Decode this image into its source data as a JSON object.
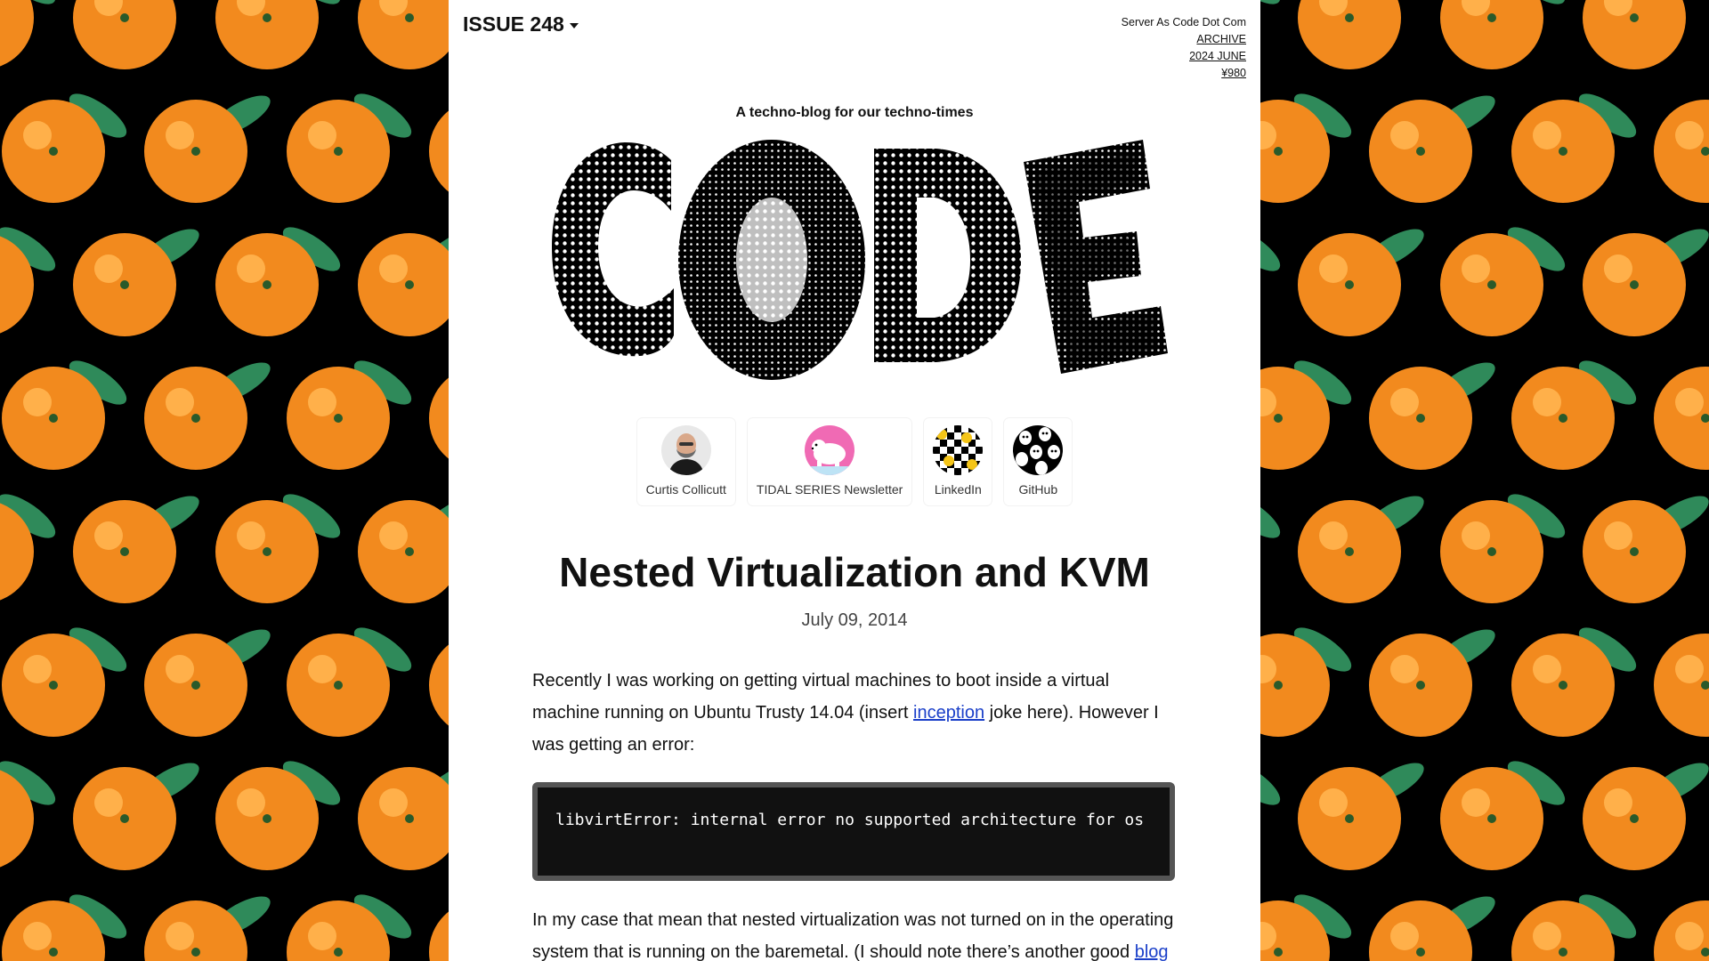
{
  "header": {
    "issue_label": "ISSUE 248",
    "site_name": "Server As Code Dot Com",
    "archive_link": "ARCHIVE",
    "date_link": "2024 JUNE",
    "price_link": "¥980"
  },
  "tagline": "A techno-blog for our techno-times",
  "logo_text": "CODE",
  "social_links": [
    {
      "label": "Curtis Collicutt",
      "icon": "portrait-avatar"
    },
    {
      "label": "TIDAL SERIES Newsletter",
      "icon": "polar-bear-avatar"
    },
    {
      "label": "LinkedIn",
      "icon": "checker-smiley-avatar"
    },
    {
      "label": "GitHub",
      "icon": "ghost-pattern-avatar"
    }
  ],
  "article": {
    "title": "Nested Virtualization and KVM",
    "date": "July 09, 2014",
    "p1_before": "Recently I was working on getting virtual machines to boot inside a virtual machine running on Ubuntu Trusty 14.04 (insert ",
    "p1_link": "inception",
    "p1_after": " joke here). However I was getting an error:",
    "code": "libvirtError: internal error no supported architecture for os",
    "p2_before": "In my case that mean that nested virtualization was not turned on in the operating system that is running on the baremetal. (I should note there’s another good ",
    "p2_link": "blog"
  },
  "colors": {
    "background": "#000000",
    "orange": "#f28a1e",
    "leaf": "#2f8a5a",
    "link": "#1a3fc9"
  }
}
